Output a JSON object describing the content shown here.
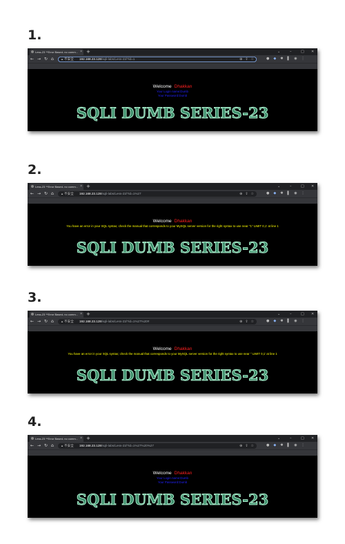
{
  "steps": [
    {
      "number": "1.",
      "tab_title": "Less-23 **Error Based- no comm...",
      "url_host": "192.168.23.128",
      "url_path": "/sqli-labs/Less-23/?id=1",
      "focused": true,
      "welcome_label": "Welcome",
      "welcome_name": "Dhakkan",
      "output_type": "info",
      "info_lines": [
        "Your Login name:Dumb",
        "Your Password:Dumb"
      ]
    },
    {
      "number": "2.",
      "tab_title": "Less-23 **Error Based- no comm...",
      "url_host": "192.168.23.128",
      "url_path": "/sqli-labs/Less-23/?id=1%27",
      "focused": false,
      "welcome_label": "Welcome",
      "welcome_name": "Dhakkan",
      "output_type": "error",
      "error_text": "You have an error in your SQL syntax; check the manual that corresponds to your MySQL server version for the right syntax to use near ''1'' LIMIT 0,1' at line 1"
    },
    {
      "number": "3.",
      "tab_title": "Less-23 **Error Based- no comm...",
      "url_host": "192.168.23.128",
      "url_path": "/sqli-labs/Less-23/?id=1%27%20#",
      "focused": false,
      "welcome_label": "Welcome",
      "welcome_name": "Dhakkan",
      "output_type": "error",
      "error_text": "You have an error in your SQL syntax; check the manual that corresponds to your MySQL server version for the right syntax to use near '' LIMIT 0,1' at line 1"
    },
    {
      "number": "4.",
      "tab_title": "Less-23 **Error Based- no comm...",
      "url_host": "192.168.23.128",
      "url_path": "/sqli-labs/Less-23/?id=1%27%20%27",
      "focused": false,
      "welcome_label": "Welcome",
      "welcome_name": "Dhakkan",
      "output_type": "info",
      "info_lines": [
        "Your Login name:Dumb",
        "Your Password:Dumb"
      ]
    }
  ],
  "browser": {
    "insecure_label": "不安全",
    "new_tab": "+",
    "bookmarks": [
      {
        "label": "Gmail",
        "icon": "gmail-icon"
      },
      {
        "label": "YouTube",
        "icon": "youtube-icon"
      },
      {
        "label": "地图",
        "icon": "maps-icon"
      },
      {
        "label": "翻译",
        "icon": "translate-icon"
      },
      {
        "label": "破解软件论坛",
        "icon": "folder-icon"
      },
      {
        "label": "学习网络",
        "icon": "folder-icon"
      },
      {
        "label": "工作协作",
        "icon": "folder-icon"
      },
      {
        "label": "结构编程",
        "icon": "folder-icon"
      },
      {
        "label": "User 账号 · jiayayWi...",
        "icon": "web-icon"
      },
      {
        "label": "https://auth0.open...",
        "icon": "web-icon"
      }
    ]
  },
  "banner_text": "SQLI DUMB SERIES-23",
  "colors": {
    "page_bg": "#000000",
    "welcome_name": "#ff2020",
    "error_text": "#ffff00",
    "info_text": "#2222ff",
    "banner_fill": "#3f8f6c",
    "banner_stroke": "#aef0d0"
  }
}
